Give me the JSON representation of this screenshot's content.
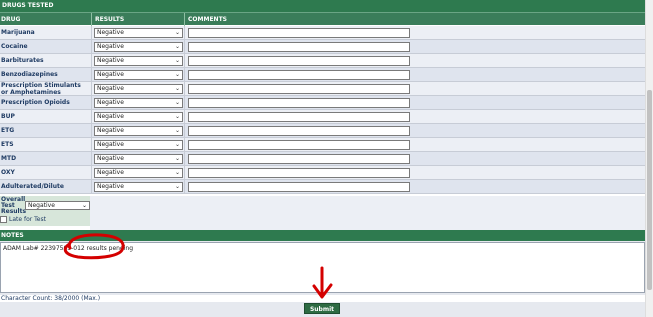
{
  "top_strip": {
    "title": "DRUGS TESTED"
  },
  "header": {
    "drug": "DRUG",
    "results": "RESULTS",
    "comments": "COMMENTS"
  },
  "rows": [
    {
      "drug": "Marijuana",
      "result": "Negative"
    },
    {
      "drug": "Cocaine",
      "result": "Negative"
    },
    {
      "drug": "Barbiturates",
      "result": "Negative"
    },
    {
      "drug": "Benzodiazepines",
      "result": "Negative"
    },
    {
      "drug": "Prescription Stimulants or Amphetamines",
      "result": "Negative"
    },
    {
      "drug": "Prescription Opioids",
      "result": "Negative"
    },
    {
      "drug": "BUP",
      "result": "Negative"
    },
    {
      "drug": "ETG",
      "result": "Negative"
    },
    {
      "drug": "ETS",
      "result": "Negative"
    },
    {
      "drug": "MTD",
      "result": "Negative"
    },
    {
      "drug": "OXY",
      "result": "Negative"
    },
    {
      "drug": "Adulterated/Dilute",
      "result": "Negative"
    }
  ],
  "overall": {
    "label_1": "Overall",
    "label_2": "Test",
    "label_3": "Results",
    "value": "Negative"
  },
  "late": {
    "label": "Late for Test"
  },
  "notes": {
    "header": "NOTES",
    "text": "ADAM Lab# 22397505-012 results pending"
  },
  "char_count": "Character Count: 38/2000 (Max.)",
  "submit_label": "Submit",
  "annotation_color": "#d40000"
}
